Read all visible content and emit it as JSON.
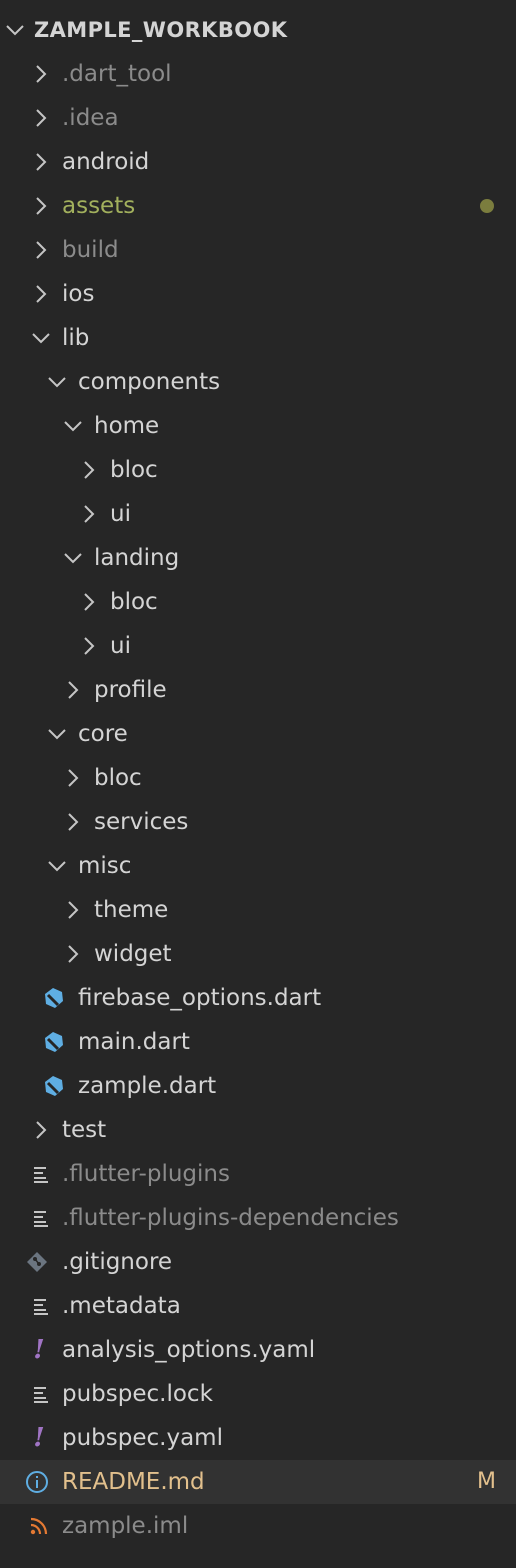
{
  "root": {
    "label": "ZAMPLE_WORKBOOK"
  },
  "items": [
    {
      "label": ".dart_tool",
      "kind": "folder",
      "state": "collapsed"
    },
    {
      "label": ".idea",
      "kind": "folder",
      "state": "collapsed"
    },
    {
      "label": "android",
      "kind": "folder",
      "state": "collapsed"
    },
    {
      "label": "assets",
      "kind": "folder",
      "state": "collapsed"
    },
    {
      "label": "build",
      "kind": "folder",
      "state": "collapsed"
    },
    {
      "label": "ios",
      "kind": "folder",
      "state": "collapsed"
    },
    {
      "label": "lib",
      "kind": "folder",
      "state": "expanded"
    },
    {
      "label": "components",
      "kind": "folder",
      "state": "expanded"
    },
    {
      "label": "home",
      "kind": "folder",
      "state": "expanded"
    },
    {
      "label": "bloc",
      "kind": "folder",
      "state": "collapsed"
    },
    {
      "label": "ui",
      "kind": "folder",
      "state": "collapsed"
    },
    {
      "label": "landing",
      "kind": "folder",
      "state": "expanded"
    },
    {
      "label": "bloc",
      "kind": "folder",
      "state": "collapsed"
    },
    {
      "label": "ui",
      "kind": "folder",
      "state": "collapsed"
    },
    {
      "label": "profile",
      "kind": "folder",
      "state": "collapsed"
    },
    {
      "label": "core",
      "kind": "folder",
      "state": "expanded"
    },
    {
      "label": "bloc",
      "kind": "folder",
      "state": "collapsed"
    },
    {
      "label": "services",
      "kind": "folder",
      "state": "collapsed"
    },
    {
      "label": "misc",
      "kind": "folder",
      "state": "expanded"
    },
    {
      "label": "theme",
      "kind": "folder",
      "state": "collapsed"
    },
    {
      "label": "widget",
      "kind": "folder",
      "state": "collapsed"
    },
    {
      "label": "firebase_options.dart",
      "kind": "file",
      "icon": "dart-icon"
    },
    {
      "label": "main.dart",
      "kind": "file",
      "icon": "dart-icon"
    },
    {
      "label": "zample.dart",
      "kind": "file",
      "icon": "dart-icon"
    },
    {
      "label": "test",
      "kind": "folder",
      "state": "collapsed"
    },
    {
      "label": ".flutter-plugins",
      "kind": "file",
      "icon": "lines-icon"
    },
    {
      "label": ".flutter-plugins-dependencies",
      "kind": "file",
      "icon": "lines-icon"
    },
    {
      "label": ".gitignore",
      "kind": "file",
      "icon": "git-icon"
    },
    {
      "label": ".metadata",
      "kind": "file",
      "icon": "lines-icon"
    },
    {
      "label": "analysis_options.yaml",
      "kind": "file",
      "icon": "yaml-icon"
    },
    {
      "label": "pubspec.lock",
      "kind": "file",
      "icon": "lines-icon"
    },
    {
      "label": "pubspec.yaml",
      "kind": "file",
      "icon": "yaml-icon"
    },
    {
      "label": "README.md",
      "kind": "file",
      "icon": "info-icon",
      "badge": "M",
      "selected": true
    },
    {
      "label": "zample.iml",
      "kind": "file",
      "icon": "rss-icon"
    }
  ],
  "colors": {
    "background": "#262626",
    "selected_row": "#323232",
    "text": "#d4d4d4",
    "ignored_text": "#8b8b8b",
    "modified_text": "#e2c08d",
    "assets_text": "#a2b05d",
    "dart_icon": "#5faee3",
    "yaml_icon": "#a074c4",
    "git_icon": "#6b7580",
    "rss_icon": "#e37933",
    "info_icon": "#5faee3",
    "dot": "#7b7d3e"
  }
}
